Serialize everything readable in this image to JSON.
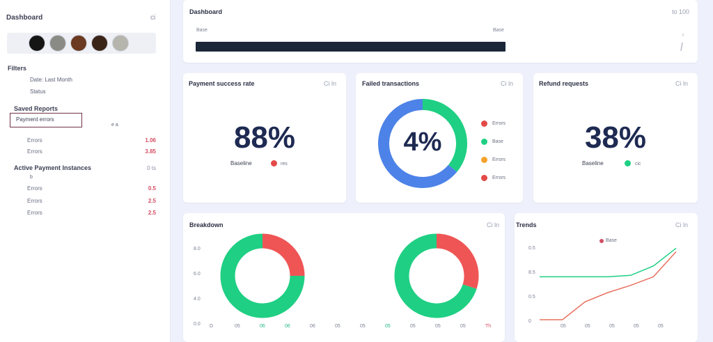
{
  "sidebar": {
    "title": "Dashboard",
    "title_icon": "ci",
    "avatars": [
      {
        "name": "avatar-1",
        "color": "#151515"
      },
      {
        "name": "avatar-2",
        "color": "#8b8b85"
      },
      {
        "name": "avatar-3",
        "color": "#6b3a20"
      },
      {
        "name": "avatar-4",
        "color": "#3a2418"
      },
      {
        "name": "avatar-5",
        "color": "#b5b5ad"
      }
    ],
    "section1_title": "Filters",
    "section1_items": [
      "Date: Last Month",
      "Status"
    ],
    "section2_title": "Saved Reports",
    "selected_item": "Payment errors",
    "selected_meta": "e a",
    "rows1": [
      {
        "label": "Errors",
        "value": "1.06"
      },
      {
        "label": "Errors",
        "value": "3.85"
      }
    ],
    "section3_title": "Active Payment Instances",
    "section3_meta": "0 ts",
    "section3_sub": "b",
    "rows2": [
      {
        "label": "Errors",
        "value": "0.5"
      },
      {
        "label": "Errors",
        "value": "2.5"
      },
      {
        "label": "Errors",
        "value": "2.5"
      }
    ]
  },
  "progress_card": {
    "title": "Dashboard",
    "meta": "to 100",
    "start_label": "Base",
    "end_label": "Base",
    "fill_fraction": 1.0,
    "color": "#1b2638",
    "scroll_icon": "scroll-handle-icon"
  },
  "stat_cards": [
    {
      "title": "Payment success rate",
      "meta": "Ci ln",
      "value": "88%",
      "legend_label": "Baseline",
      "legend_color": "#e34a47",
      "legend_text": "res"
    },
    {
      "title": "Failed transactions",
      "meta": "Ci ln",
      "value": "4%",
      "donut_green": 0.36,
      "donut_blue": 0.64,
      "colors": {
        "green": "#1fcf83",
        "blue": "#4d83e8"
      },
      "legend": [
        {
          "label": "Errors",
          "color": "#e34a47"
        },
        {
          "label": "Base",
          "color": "#1fcf83"
        },
        {
          "label": "Errors",
          "color": "#f2a22c"
        },
        {
          "label": "Errors",
          "color": "#e34a47"
        }
      ]
    },
    {
      "title": "Refund requests",
      "meta": "Ci ln",
      "value": "38%",
      "legend_label": "Baseline",
      "legend_color": "#1fcf83",
      "legend_text": "cic"
    }
  ],
  "breakdown_card": {
    "title": "Breakdown",
    "meta": "Ci ln",
    "y_labels": [
      "8.0",
      "6.0",
      "4.0",
      "0.0"
    ],
    "x_labels": [
      {
        "t": "D",
        "c": ""
      },
      {
        "t": "05",
        "c": ""
      },
      {
        "t": "06",
        "c": "hi"
      },
      {
        "t": "06",
        "c": "hi"
      },
      {
        "t": "06",
        "c": ""
      },
      {
        "t": "05",
        "c": ""
      },
      {
        "t": "05",
        "c": ""
      },
      {
        "t": "05",
        "c": "hi"
      },
      {
        "t": "05",
        "c": ""
      },
      {
        "t": "05",
        "c": ""
      },
      {
        "t": "05",
        "c": ""
      },
      {
        "t": "Th",
        "c": "red"
      }
    ],
    "donuts": [
      {
        "red": 0.25,
        "green": 0.75
      },
      {
        "red": 0.3,
        "green": 0.7
      }
    ],
    "colors": {
      "red": "#ef5555",
      "green": "#1fcf83"
    }
  },
  "trend_card": {
    "title": "Trends",
    "meta": "Ci ln",
    "legend_label": "Base",
    "legend_color": "#d44e63",
    "y_labels": [
      "0.5",
      "8.5",
      "0.5",
      "0"
    ],
    "x_labels": [
      "05",
      "05",
      "05",
      "05",
      "05"
    ],
    "chart_data": {
      "type": "line",
      "categories": [
        "",
        "05",
        "05",
        "05",
        "05",
        "05",
        ""
      ],
      "series": [
        {
          "name": "Base",
          "color": "#1fcf83",
          "values": [
            0.6,
            0.6,
            0.6,
            0.6,
            0.62,
            0.75,
            1.0
          ]
        },
        {
          "name": "",
          "color": "#e8705f",
          "values": [
            0.0,
            0.0,
            0.25,
            0.38,
            0.48,
            0.6,
            0.95
          ]
        }
      ],
      "ylim": [
        0,
        1.1
      ]
    }
  }
}
